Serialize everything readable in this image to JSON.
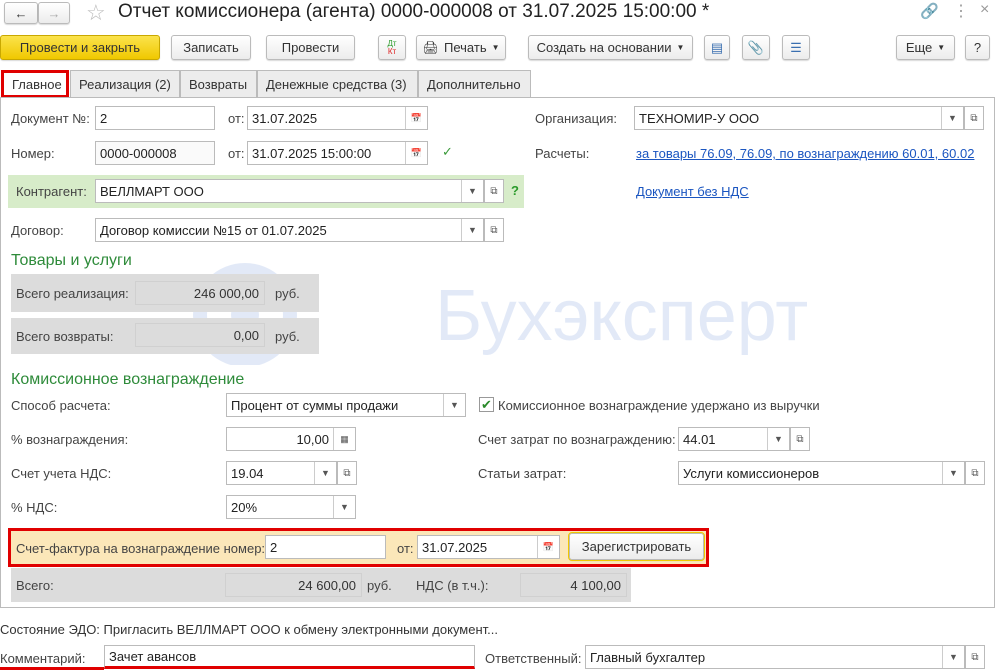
{
  "window": {
    "title": "Отчет комиссионера (агента) 0000-000008 от 31.07.2025 15:00:00 *"
  },
  "toolbar": {
    "post_close": "Провести и закрыть",
    "save": "Записать",
    "post": "Провести",
    "dtkt_dt": "Дт",
    "dtkt_kt": "Кт",
    "print": "Печать",
    "create_based": "Создать на основании",
    "more": "Еще",
    "help": "?"
  },
  "tabs": [
    {
      "label": "Главное"
    },
    {
      "label": "Реализация (2)"
    },
    {
      "label": "Возвраты"
    },
    {
      "label": "Денежные средства (3)"
    },
    {
      "label": "Дополнительно"
    }
  ],
  "form": {
    "doc_no_label": "Документ №:",
    "doc_no": "2",
    "from_label": "от:",
    "doc_date": "31.07.2025",
    "number_label": "Номер:",
    "number": "0000-000008",
    "number_date": "31.07.2025 15:00:00",
    "org_label": "Организация:",
    "org": "ТЕХНОМИР-У ООО",
    "settlements_label": "Расчеты:",
    "settlements_link": "за товары 76.09, 76.09, по вознаграждению 60.01, 60.02",
    "vat_doc_link": "Документ без НДС",
    "counterparty_label": "Контрагент:",
    "counterparty": "ВЕЛЛМАРТ ООО",
    "help": "?",
    "contract_label": "Договор:",
    "contract": "Договор комиссии №15 от 01.07.2025"
  },
  "goods": {
    "heading": "Товары и услуги",
    "sales_label": "Всего реализация:",
    "sales": "246 000,00",
    "returns_label": "Всего возвраты:",
    "returns": "0,00",
    "currency": "руб."
  },
  "commission": {
    "heading": "Комиссионное вознаграждение",
    "method_label": "Способ расчета:",
    "method": "Процент от суммы продажи",
    "withheld_checked": true,
    "withheld_label": "Комиссионное вознаграждение удержано из выручки",
    "percent_label": "% вознаграждения:",
    "percent": "10,00",
    "cost_account_label": "Счет затрат по вознаграждению:",
    "cost_account": "44.01",
    "vat_account_label": "Счет учета НДС:",
    "vat_account": "19.04",
    "cost_items_label": "Статьи затрат:",
    "cost_items": "Услуги комиссионеров",
    "vat_rate_label": "% НДС:",
    "vat_rate": "20%"
  },
  "invoice": {
    "label": "Счет-фактура на вознаграждение номер:",
    "number": "2",
    "from_label": "от:",
    "date": "31.07.2025",
    "register": "Зарегистрировать"
  },
  "totals": {
    "total_label": "Всего:",
    "total": "24 600,00",
    "currency": "руб.",
    "vat_label": "НДС (в т.ч.):",
    "vat": "4 100,00"
  },
  "edo": {
    "status": "Состояние ЭДО: Пригласить ВЕЛЛМАРТ ООО к обмену электронными документ..."
  },
  "footer": {
    "comment_label": "Комментарий:",
    "comment": "Зачет авансов",
    "responsible_label": "Ответственный:",
    "responsible": "Главный бухгалтер"
  },
  "watermark": "Бухэксперт",
  "colors": {
    "accent_yellow": "#f5d31a",
    "highlight_red": "#e00000",
    "green_heading": "#2e8b3a",
    "link": "#1a55c0"
  }
}
